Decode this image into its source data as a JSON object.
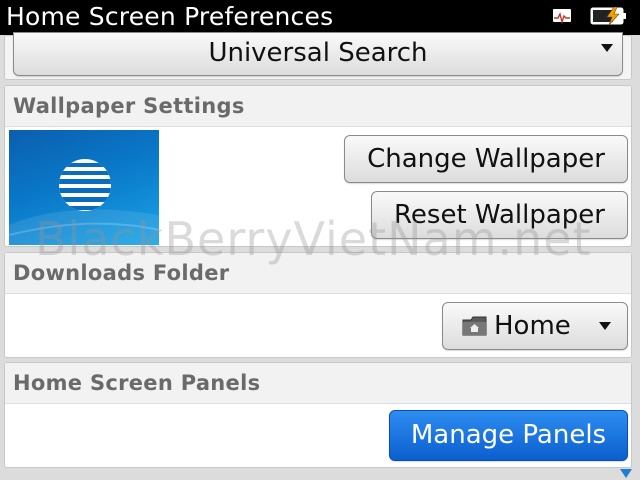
{
  "title_bar": {
    "title": "Home Screen Preferences",
    "icons": [
      "signal-icon",
      "battery-charging-icon"
    ]
  },
  "search_dropdown": {
    "value": "Universal Search"
  },
  "wallpaper_section": {
    "header": "Wallpaper Settings",
    "change_label": "Change Wallpaper",
    "reset_label": "Reset Wallpaper"
  },
  "downloads_section": {
    "header": "Downloads Folder",
    "folder_value": "Home",
    "folder_icon": "folder-icon"
  },
  "panels_section": {
    "header": "Home Screen Panels",
    "manage_label": "Manage Panels"
  },
  "watermark": "BlackBerryVietNam.net",
  "colors": {
    "accent": "#0b5fcf",
    "title_bg": "#000000",
    "header_text": "#6a6a6a",
    "scroll_arrow": "#1e7fd2"
  }
}
